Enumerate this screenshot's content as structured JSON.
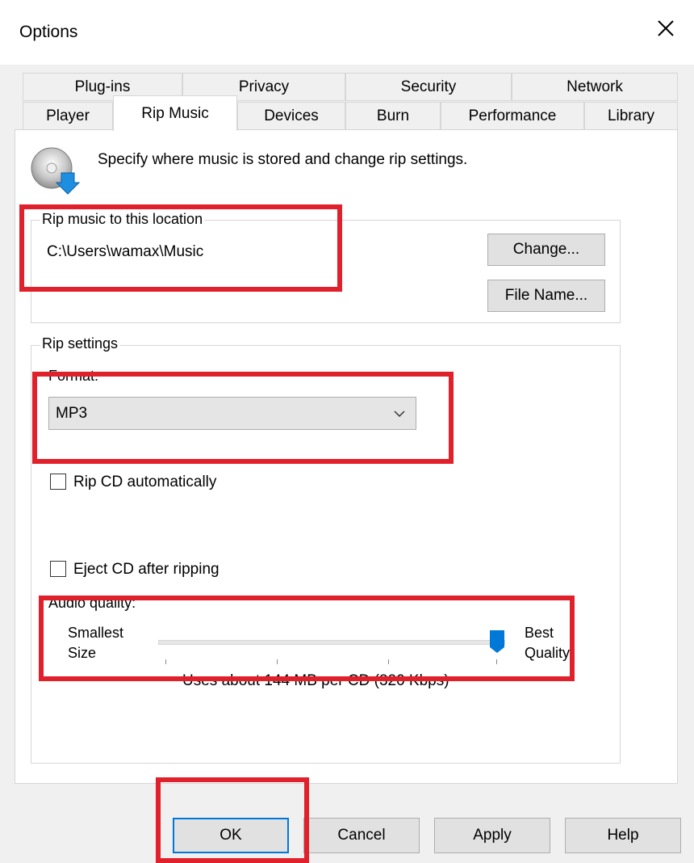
{
  "dialog": {
    "title": "Options"
  },
  "tabs": {
    "row_top": [
      "Plug-ins",
      "Privacy",
      "Security",
      "Network"
    ],
    "row_bottom": [
      "Player",
      "Rip Music",
      "Devices",
      "Burn",
      "Performance",
      "Library"
    ],
    "active": "Rip Music"
  },
  "intro": {
    "text": "Specify where music is stored and change rip settings."
  },
  "location": {
    "group_label": "Rip music to this location",
    "path": "C:\\Users\\wamax\\Music",
    "change_button": "Change...",
    "filename_button": "File Name..."
  },
  "rip_settings": {
    "group_label": "Rip settings",
    "format_label": "Format:",
    "format_value": "MP3",
    "rip_cd_auto": {
      "label": "Rip CD automatically",
      "checked": false
    },
    "eject_cd": {
      "label": "Eject CD after ripping",
      "checked": false
    },
    "audio_quality_label": "Audio quality:",
    "slider_min_label_1": "Smallest",
    "slider_min_label_2": "Size",
    "slider_max_label_1": "Best",
    "slider_max_label_2": "Quality",
    "slider_position_fraction": 1.0,
    "uses_text": "Uses about 144 MB per CD (320 Kbps)"
  },
  "footer": {
    "ok": "OK",
    "cancel": "Cancel",
    "apply": "Apply",
    "help": "Help"
  },
  "colors": {
    "annotation": "#e0202a",
    "accent": "#0078d7",
    "slider_thumb": "#0078d7"
  },
  "icons": {
    "close": "close-icon",
    "disc": "cd-rip-icon",
    "dropdown": "chevron-down-icon"
  }
}
